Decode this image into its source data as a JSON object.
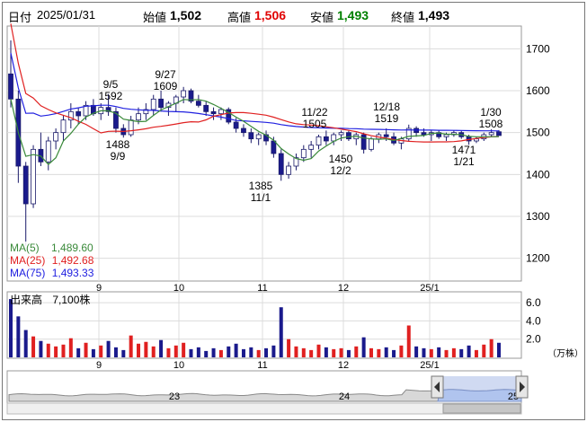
{
  "header": {
    "date_label": "日付",
    "date_value": "2025/01/31",
    "open_label": "始値",
    "open_value": "1,502",
    "high_label": "高値",
    "high_value": "1,506",
    "low_label": "安値",
    "low_value": "1,493",
    "close_label": "終値",
    "close_value": "1,493"
  },
  "colors": {
    "up": "#1a1a8c",
    "down": "#ffffff",
    "ma5": "#3a8a3a",
    "ma25": "#e02020",
    "ma75": "#2020e0",
    "high_text": "#e00000",
    "low_text": "#008000",
    "vol_up": "#e02020",
    "vol_down": "#1a1a8c"
  },
  "ma_legend": [
    {
      "label": "MA(5)",
      "value": "1,489.60"
    },
    {
      "label": "MA(25)",
      "value": "1,492.68"
    },
    {
      "label": "MA(75)",
      "value": "1,493.33"
    }
  ],
  "price_axis": [
    "1700",
    "1600",
    "1500",
    "1400",
    "1300",
    "1200"
  ],
  "x_ticks": [
    "9",
    "10",
    "11",
    "12",
    "25/1"
  ],
  "annotations": [
    {
      "date": "9/5",
      "price": "1592"
    },
    {
      "date": "9/27",
      "price": "1609"
    },
    {
      "date": "9/9",
      "price": "1488"
    },
    {
      "date": "11/1",
      "price": "1385"
    },
    {
      "date": "11/22",
      "price": "1505"
    },
    {
      "date": "12/2",
      "price": "1450"
    },
    {
      "date": "12/18",
      "price": "1519"
    },
    {
      "date": "1/21",
      "price": "1471"
    },
    {
      "date": "1/30",
      "price": "1508"
    }
  ],
  "volume": {
    "title": "出来高",
    "value": "7,100株",
    "axis": [
      "6.0",
      "4.0",
      "2.0"
    ],
    "unit": "（万株）"
  },
  "navigator": {
    "year_labels": [
      "23",
      "24",
      "25"
    ],
    "left_handle_icon": "left-arrow-icon",
    "right_handle_icon": "right-arrow-icon"
  },
  "chart_data": {
    "type": "candlestick",
    "ylim": [
      1150,
      1750
    ],
    "ma_series": [
      {
        "name": "MA(5)",
        "last": 1489.6
      },
      {
        "name": "MA(25)",
        "last": 1492.68
      },
      {
        "name": "MA(75)",
        "last": 1493.33
      }
    ],
    "ohlc": [
      [
        1640,
        1720,
        1560,
        1580
      ],
      [
        1580,
        1600,
        1380,
        1420
      ],
      [
        1420,
        1430,
        1230,
        1330
      ],
      [
        1330,
        1470,
        1320,
        1460
      ],
      [
        1460,
        1500,
        1420,
        1430
      ],
      [
        1430,
        1490,
        1410,
        1480
      ],
      [
        1480,
        1510,
        1460,
        1500
      ],
      [
        1500,
        1540,
        1480,
        1530
      ],
      [
        1530,
        1570,
        1510,
        1550
      ],
      [
        1550,
        1560,
        1520,
        1540
      ],
      [
        1540,
        1575,
        1530,
        1565
      ],
      [
        1565,
        1580,
        1540,
        1545
      ],
      [
        1545,
        1570,
        1530,
        1560
      ],
      [
        1560,
        1592,
        1540,
        1550
      ],
      [
        1550,
        1560,
        1500,
        1510
      ],
      [
        1510,
        1520,
        1488,
        1495
      ],
      [
        1495,
        1540,
        1490,
        1530
      ],
      [
        1530,
        1560,
        1520,
        1545
      ],
      [
        1545,
        1570,
        1530,
        1555
      ],
      [
        1555,
        1590,
        1540,
        1580
      ],
      [
        1580,
        1600,
        1550,
        1560
      ],
      [
        1560,
        1575,
        1540,
        1570
      ],
      [
        1570,
        1590,
        1550,
        1585
      ],
      [
        1585,
        1609,
        1570,
        1600
      ],
      [
        1600,
        1605,
        1570,
        1575
      ],
      [
        1575,
        1590,
        1560,
        1565
      ],
      [
        1565,
        1575,
        1540,
        1550
      ],
      [
        1550,
        1560,
        1530,
        1545
      ],
      [
        1545,
        1560,
        1530,
        1555
      ],
      [
        1555,
        1560,
        1520,
        1525
      ],
      [
        1525,
        1535,
        1500,
        1510
      ],
      [
        1510,
        1520,
        1490,
        1500
      ],
      [
        1500,
        1510,
        1475,
        1485
      ],
      [
        1485,
        1500,
        1470,
        1495
      ],
      [
        1495,
        1505,
        1470,
        1480
      ],
      [
        1480,
        1490,
        1440,
        1450
      ],
      [
        1450,
        1460,
        1385,
        1400
      ],
      [
        1400,
        1430,
        1390,
        1420
      ],
      [
        1420,
        1450,
        1410,
        1440
      ],
      [
        1440,
        1470,
        1430,
        1460
      ],
      [
        1460,
        1480,
        1440,
        1470
      ],
      [
        1470,
        1495,
        1460,
        1490
      ],
      [
        1490,
        1505,
        1470,
        1480
      ],
      [
        1480,
        1500,
        1470,
        1495
      ],
      [
        1495,
        1505,
        1480,
        1500
      ],
      [
        1500,
        1505,
        1480,
        1485
      ],
      [
        1485,
        1500,
        1470,
        1495
      ],
      [
        1495,
        1500,
        1450,
        1460
      ],
      [
        1460,
        1490,
        1455,
        1485
      ],
      [
        1485,
        1500,
        1475,
        1495
      ],
      [
        1495,
        1510,
        1480,
        1490
      ],
      [
        1490,
        1500,
        1470,
        1475
      ],
      [
        1475,
        1490,
        1460,
        1485
      ],
      [
        1485,
        1519,
        1480,
        1510
      ],
      [
        1510,
        1515,
        1490,
        1500
      ],
      [
        1500,
        1510,
        1490,
        1495
      ],
      [
        1495,
        1505,
        1480,
        1500
      ],
      [
        1500,
        1505,
        1485,
        1490
      ],
      [
        1490,
        1500,
        1480,
        1495
      ],
      [
        1495,
        1505,
        1490,
        1500
      ],
      [
        1500,
        1505,
        1485,
        1490
      ],
      [
        1490,
        1495,
        1471,
        1480
      ],
      [
        1480,
        1490,
        1475,
        1485
      ],
      [
        1485,
        1500,
        1480,
        1495
      ],
      [
        1495,
        1508,
        1490,
        1500
      ],
      [
        1502,
        1506,
        1493,
        1493
      ]
    ]
  }
}
